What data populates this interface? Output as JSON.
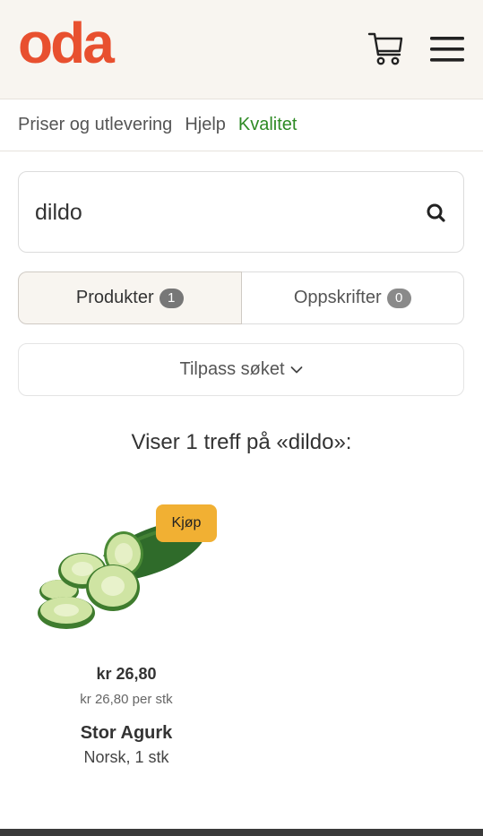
{
  "header": {
    "logo": "oda",
    "cart_icon": "cart-icon",
    "menu_icon": "hamburger-menu-icon"
  },
  "nav": {
    "items": [
      "Priser og utlevering",
      "Hjelp",
      "Kvalitet"
    ],
    "active_color": "#2e8a24"
  },
  "search": {
    "value": "dildo",
    "icon": "search-icon"
  },
  "tabs": [
    {
      "label": "Produkter",
      "count": "1",
      "selected": true
    },
    {
      "label": "Oppskrifter",
      "count": "0",
      "selected": false
    }
  ],
  "refine": {
    "label": "Tilpass søket",
    "icon": "chevron-down-icon"
  },
  "results": {
    "title": "Viser 1 treff på «dildo»:"
  },
  "product": {
    "buy_label": "Kjøp",
    "price": "kr 26,80",
    "unit_price": "kr 26,80 per stk",
    "name": "Stor Agurk",
    "description": "Norsk, 1 stk"
  },
  "colors": {
    "brand": "#e8502f",
    "header_bg": "#f8f5f0",
    "buy_button": "#f1b033"
  }
}
